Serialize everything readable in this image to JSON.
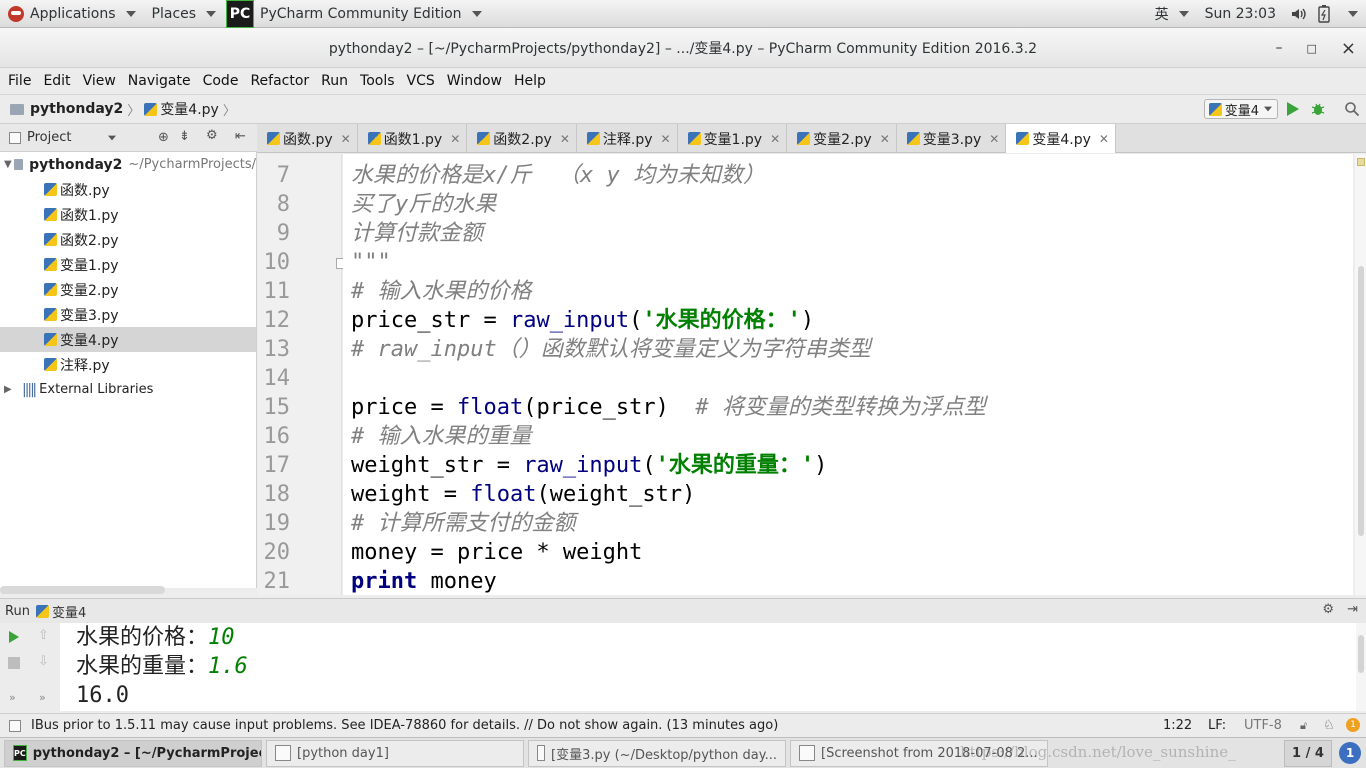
{
  "topbar": {
    "applications": "Applications",
    "places": "Places",
    "app_name": "PyCharm Community Edition",
    "app_logo": "PC",
    "input_method": "英",
    "clock": "Sun 23:03"
  },
  "window": {
    "title": "pythonday2 – [~/PycharmProjects/pythonday2] – .../变量4.py – PyCharm Community Edition 2016.3.2",
    "minimize": "–",
    "maximize": "□",
    "close": "×"
  },
  "menu": [
    "File",
    "Edit",
    "View",
    "Navigate",
    "Code",
    "Refactor",
    "Run",
    "Tools",
    "VCS",
    "Window",
    "Help"
  ],
  "navbar": {
    "project": "pythonday2",
    "file": "变量4.py",
    "run_config": "变量4"
  },
  "project_panel": {
    "title": "Project",
    "root_name": "pythonday2",
    "root_path": "~/PycharmProjects/",
    "files": [
      "函数.py",
      "函数1.py",
      "函数2.py",
      "变量1.py",
      "变量2.py",
      "变量3.py",
      "变量4.py",
      "注释.py"
    ],
    "selected_file": "变量4.py",
    "external": "External Libraries"
  },
  "tabs": [
    {
      "label": "函数.py",
      "active": false
    },
    {
      "label": "函数1.py",
      "active": false
    },
    {
      "label": "函数2.py",
      "active": false
    },
    {
      "label": "注释.py",
      "active": false
    },
    {
      "label": "变量1.py",
      "active": false
    },
    {
      "label": "变量2.py",
      "active": false
    },
    {
      "label": "变量3.py",
      "active": false
    },
    {
      "label": "变量4.py",
      "active": true
    }
  ],
  "editor": {
    "line_numbers": [
      "7",
      "8",
      "9",
      "10",
      "11",
      "12",
      "13",
      "14",
      "15",
      "16",
      "17",
      "18",
      "19",
      "20",
      "21"
    ],
    "lines": [
      [
        [
          "cm",
          "水果的价格是x/斤  （x y 均为未知数）"
        ]
      ],
      [
        [
          "cm",
          "买了y斤的水果"
        ]
      ],
      [
        [
          "cm",
          "计算付款金额"
        ]
      ],
      [
        [
          "cm",
          "\"\"\""
        ]
      ],
      [
        [
          "cm",
          "# 输入水果的价格"
        ]
      ],
      [
        [
          "",
          "price_str = "
        ],
        [
          "bi",
          "raw_input"
        ],
        [
          "",
          "("
        ],
        [
          "st",
          "'水果的价格：'"
        ],
        [
          "",
          ")"
        ]
      ],
      [
        [
          "cm",
          "# raw_input（）函数默认将变量定义为字符串类型"
        ]
      ],
      [
        [
          "",
          ""
        ]
      ],
      [
        [
          "",
          "price = "
        ],
        [
          "bi",
          "float"
        ],
        [
          "",
          "(price_str)  "
        ],
        [
          "cm",
          "# 将变量的类型转换为浮点型"
        ]
      ],
      [
        [
          "cm",
          "# 输入水果的重量"
        ]
      ],
      [
        [
          "",
          "weight_str = "
        ],
        [
          "bi",
          "raw_input"
        ],
        [
          "",
          "("
        ],
        [
          "st",
          "'水果的重量：'"
        ],
        [
          "",
          ")"
        ]
      ],
      [
        [
          "",
          "weight = "
        ],
        [
          "bi",
          "float"
        ],
        [
          "",
          "(weight_str)"
        ]
      ],
      [
        [
          "cm",
          "# 计算所需支付的金额"
        ]
      ],
      [
        [
          "",
          "money = price * weight"
        ]
      ],
      [
        [
          "kw",
          "print"
        ],
        [
          "",
          " money"
        ]
      ]
    ]
  },
  "run_panel": {
    "label": "Run",
    "config": "变量4",
    "output": [
      {
        "prompt": "水果的价格：",
        "value": "10"
      },
      {
        "prompt": "水果的重量：",
        "value": "1.6"
      },
      {
        "prompt": "16.0",
        "value": ""
      }
    ]
  },
  "status": {
    "message": "IBus prior to 1.5.11 may cause input problems. See IDEA-78860 for details. // Do not show again. (13 minutes ago)",
    "position": "1:22",
    "line_sep": "LF:",
    "encoding": "UTF-8"
  },
  "taskbar": {
    "tasks": [
      {
        "label": "pythonday2 – [~/PycharmProject...",
        "active": true
      },
      {
        "label": "[python day1]",
        "active": false
      },
      {
        "label": "[变量3.py (~/Desktop/python day...",
        "active": false
      },
      {
        "label": "[Screenshot from 2018-07-08 2...",
        "active": false
      }
    ],
    "workspace": "1 / 4",
    "watermark": "https://blog.csdn.net/love_sunshine_"
  }
}
